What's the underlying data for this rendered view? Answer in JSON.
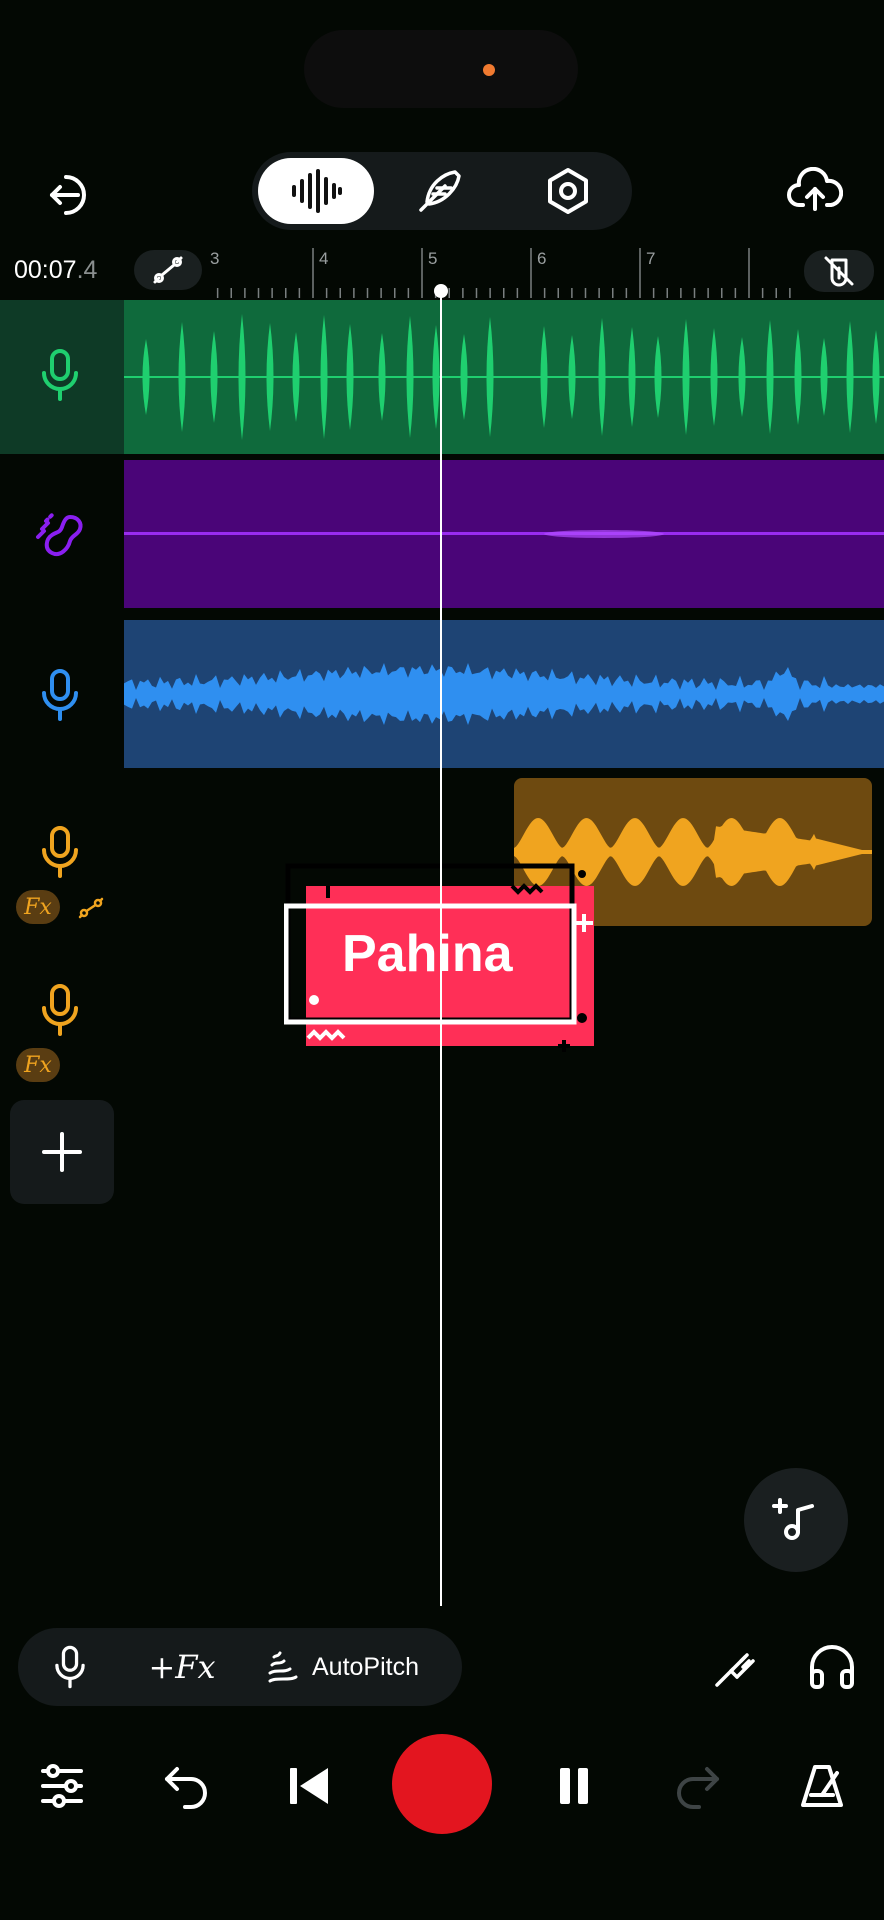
{
  "header": {
    "time_main": "00:07",
    "time_frac": ".4",
    "ruler_ticks": [
      "3",
      "4",
      "5",
      "6",
      "7"
    ],
    "modes": [
      "waveform-icon",
      "feather-icon",
      "hexagon-settings-icon"
    ]
  },
  "tracks": [
    {
      "type": "vocal",
      "color": "#1fcf6f",
      "icon": "mic-icon"
    },
    {
      "type": "instrument",
      "color": "#8a1ff0",
      "icon": "guitar-icon"
    },
    {
      "type": "vocal",
      "color": "#2f8ff0",
      "icon": "mic-icon"
    },
    {
      "type": "vocal-fx",
      "color": "#f0a41f",
      "icon": "mic-icon",
      "fx_label": "Fx"
    },
    {
      "type": "vocal-fx",
      "color": "#f0a41f",
      "icon": "mic-icon",
      "fx_label": "Fx"
    }
  ],
  "sticker": {
    "text": "Pahina",
    "color": "#ff2f57"
  },
  "toolbar": {
    "fx_label": "+Fx",
    "autopitch_label": "AutoPitch"
  },
  "colors": {
    "record": "#e3151f",
    "accent_green": "#1fcf6f",
    "accent_orange": "#f07a30"
  }
}
